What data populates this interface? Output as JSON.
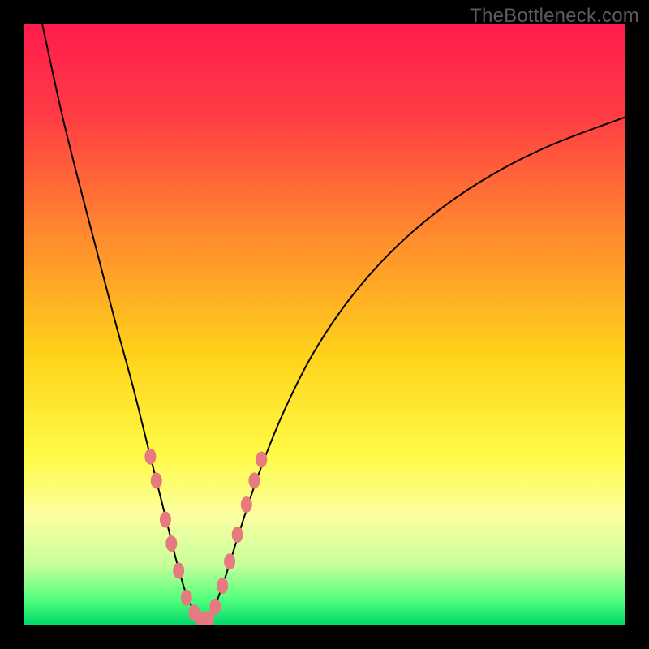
{
  "watermark": "TheBottleneck.com",
  "chart_data": {
    "type": "line",
    "title": "",
    "xlabel": "",
    "ylabel": "",
    "xlim": [
      0,
      100
    ],
    "ylim": [
      0,
      100
    ],
    "background_gradient": {
      "stops": [
        {
          "offset": 0.0,
          "color": "#ff1c4c"
        },
        {
          "offset": 0.15,
          "color": "#ff3b44"
        },
        {
          "offset": 0.35,
          "color": "#ff8a2e"
        },
        {
          "offset": 0.55,
          "color": "#ffd21a"
        },
        {
          "offset": 0.72,
          "color": "#fffb47"
        },
        {
          "offset": 0.82,
          "color": "#fbffa2"
        },
        {
          "offset": 0.9,
          "color": "#c7ff9a"
        },
        {
          "offset": 0.96,
          "color": "#4eff7c"
        },
        {
          "offset": 1.0,
          "color": "#00d96a"
        }
      ]
    },
    "series": [
      {
        "name": "left-arm",
        "stroke": "#000000",
        "stroke_width": 2,
        "points": [
          {
            "x": 3.0,
            "y": 100.0
          },
          {
            "x": 4.5,
            "y": 93.0
          },
          {
            "x": 6.5,
            "y": 84.0
          },
          {
            "x": 9.0,
            "y": 74.0
          },
          {
            "x": 12.0,
            "y": 62.5
          },
          {
            "x": 15.0,
            "y": 51.0
          },
          {
            "x": 18.0,
            "y": 40.0
          },
          {
            "x": 20.5,
            "y": 30.0
          },
          {
            "x": 22.5,
            "y": 22.0
          },
          {
            "x": 24.0,
            "y": 16.0
          },
          {
            "x": 25.5,
            "y": 10.0
          },
          {
            "x": 27.0,
            "y": 5.0
          },
          {
            "x": 28.5,
            "y": 2.0
          },
          {
            "x": 30.0,
            "y": 0.5
          }
        ]
      },
      {
        "name": "right-arm",
        "stroke": "#000000",
        "stroke_width": 2,
        "points": [
          {
            "x": 30.0,
            "y": 0.5
          },
          {
            "x": 31.5,
            "y": 2.5
          },
          {
            "x": 33.5,
            "y": 8.0
          },
          {
            "x": 36.0,
            "y": 16.0
          },
          {
            "x": 39.0,
            "y": 25.0
          },
          {
            "x": 43.0,
            "y": 35.0
          },
          {
            "x": 48.0,
            "y": 45.0
          },
          {
            "x": 54.0,
            "y": 54.0
          },
          {
            "x": 61.0,
            "y": 62.0
          },
          {
            "x": 69.0,
            "y": 69.0
          },
          {
            "x": 78.0,
            "y": 75.0
          },
          {
            "x": 88.0,
            "y": 80.0
          },
          {
            "x": 100.0,
            "y": 84.5
          }
        ]
      }
    ],
    "markers": {
      "color": "#e77a7f",
      "rx": 7,
      "ry": 10,
      "points": [
        {
          "x": 21.0,
          "y": 28.0
        },
        {
          "x": 22.0,
          "y": 24.0
        },
        {
          "x": 23.5,
          "y": 17.5
        },
        {
          "x": 24.5,
          "y": 13.5
        },
        {
          "x": 25.7,
          "y": 9.0
        },
        {
          "x": 27.0,
          "y": 4.5
        },
        {
          "x": 28.3,
          "y": 2.0
        },
        {
          "x": 29.5,
          "y": 0.8
        },
        {
          "x": 30.7,
          "y": 1.0
        },
        {
          "x": 31.8,
          "y": 3.0
        },
        {
          "x": 33.0,
          "y": 6.5
        },
        {
          "x": 34.2,
          "y": 10.5
        },
        {
          "x": 35.5,
          "y": 15.0
        },
        {
          "x": 37.0,
          "y": 20.0
        },
        {
          "x": 38.3,
          "y": 24.0
        },
        {
          "x": 39.5,
          "y": 27.5
        }
      ]
    }
  }
}
